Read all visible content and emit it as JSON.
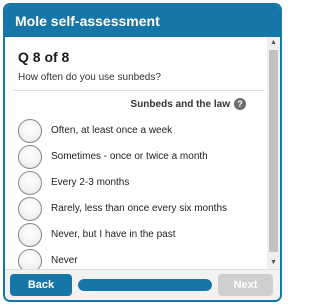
{
  "header": {
    "title": "Mole self-assessment"
  },
  "question": {
    "number": "Q 8 of 8",
    "text": "How often do you use sunbeds?",
    "help_link": "Sunbeds and the law",
    "help_icon": "?"
  },
  "options": [
    {
      "label": "Often, at least once a week"
    },
    {
      "label": "Sometimes - once or twice a month"
    },
    {
      "label": "Every 2-3 months"
    },
    {
      "label": "Rarely, less than once every six months"
    },
    {
      "label": "Never, but I have in the past"
    },
    {
      "label": "Never"
    }
  ],
  "scrollbar": {
    "up_icon": "▲",
    "down_icon": "▼"
  },
  "footer": {
    "back_label": "Back",
    "next_label": "Next",
    "progress_fraction": 1.0
  },
  "colors": {
    "brand": "#1676a8",
    "disabled": "#cfcfcf"
  }
}
